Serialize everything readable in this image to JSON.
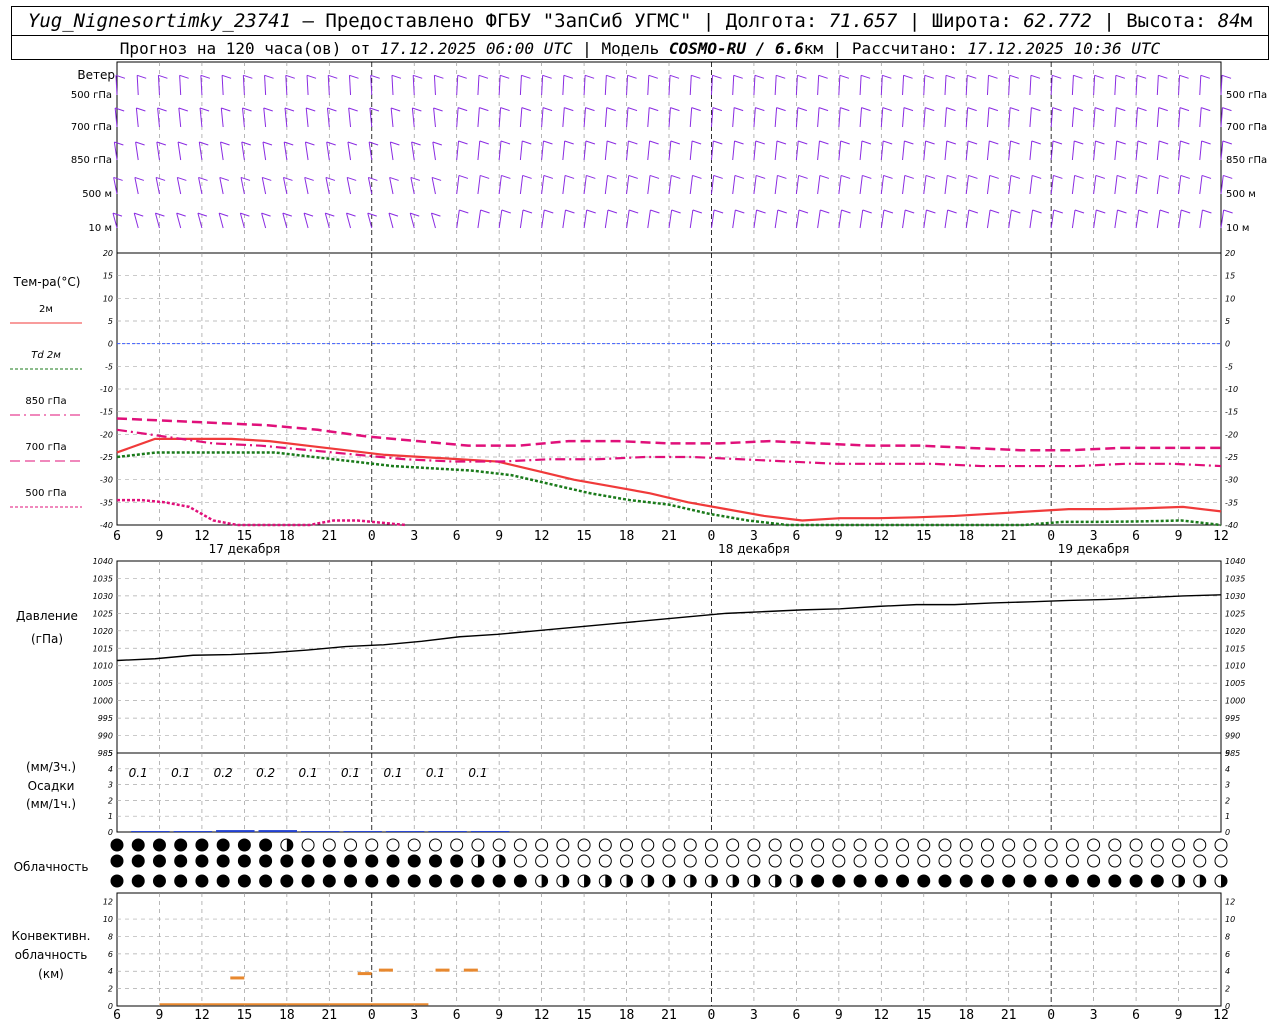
{
  "header": {
    "station": "Yug_Nignesortimky_23741",
    "dash": "—",
    "provider": "Предоставлено ФГБУ \"ЗапСиб УГМС\"",
    "lon_label": "Долгота:",
    "lon": "71.657",
    "lat_label": "Широта:",
    "lat": "62.772",
    "alt_label": "Высота:",
    "alt": "84",
    "alt_unit": "м",
    "forecast_label": "Прогноз на 120 часа(ов) от",
    "forecast_start": "17.12.2025 06:00 UTC",
    "model_label": "Модель",
    "model": "COSMO-RU / 6.6",
    "model_unit": "км",
    "calc_label": "Рассчитано:",
    "calc_time": "17.12.2025 10:36 UTC"
  },
  "wind": {
    "title": "Ветер",
    "levels": [
      "500 гПа",
      "700 гПа",
      "850 гПа",
      "500 м",
      "10  м"
    ]
  },
  "temperature": {
    "title": "Тем-ра(°C)",
    "legend": [
      {
        "label": "2м",
        "color": "#f03a3a",
        "style": "solid"
      },
      {
        "label": "Td  2м",
        "color": "#1a7a1a",
        "style": "dotted"
      },
      {
        "label": "850 гПа",
        "color": "#e0107a",
        "style": "dashdot"
      },
      {
        "label": "700 гПа",
        "color": "#e0107a",
        "style": "dash"
      },
      {
        "label": "500 гПа",
        "color": "#e0107a",
        "style": "dotted"
      }
    ],
    "yticks": [
      "20",
      "15",
      "10",
      "5",
      "0",
      "-5",
      "-10",
      "-15",
      "-20",
      "-25",
      "-30",
      "-35",
      "-40"
    ]
  },
  "pressure": {
    "title1": "Давление",
    "title2": "(гПа)",
    "yticks": [
      "1040",
      "1035",
      "1030",
      "1025",
      "1020",
      "1015",
      "1010",
      "1005",
      "1000",
      "995",
      "990",
      "985"
    ]
  },
  "precip": {
    "title1": "(мм/3ч.)",
    "title2": "Осадки",
    "title3": "(мм/1ч.)",
    "yticks": [
      "5",
      "4",
      "3",
      "2",
      "1",
      "0"
    ],
    "amounts": [
      "0.1",
      "0.1",
      "0.2",
      "0.2",
      "0.1",
      "0.1",
      "0.1",
      "0.1",
      "0.1"
    ]
  },
  "cloud": {
    "title": "Облачность"
  },
  "convective": {
    "title1": "Конвективн.",
    "title2": "облачность",
    "title3": "(км)",
    "yticks": [
      "12",
      "10",
      "8",
      "6",
      "4",
      "2",
      "0"
    ]
  },
  "time_axis": {
    "hour_labels": [
      "6",
      "9",
      "12",
      "15",
      "18",
      "21",
      "0",
      "3",
      "6",
      "9",
      "12",
      "15",
      "18",
      "21",
      "0",
      "3",
      "6",
      "9",
      "12",
      "15",
      "18",
      "21",
      "0",
      "3",
      "6",
      "9",
      "12"
    ],
    "day_labels": [
      "17 декабря",
      "18 декабря",
      "19 декабря"
    ]
  },
  "chart_data": {
    "type": "line",
    "x_hours_from_start": [
      0,
      3,
      6,
      9,
      12,
      15,
      18,
      21,
      24,
      27,
      30,
      33,
      36,
      39,
      42,
      45,
      48,
      51,
      54,
      57,
      60,
      63,
      66,
      69,
      72,
      75,
      78
    ],
    "temp_series": [
      {
        "name": "2м",
        "values": [
          -24,
          -21,
          -21,
          -21,
          -21.5,
          -22.5,
          -23.5,
          -24.5,
          -25,
          -25.5,
          -26,
          -28,
          -30,
          -31.5,
          -33,
          -35,
          -36.5,
          -38,
          -39,
          -38.5,
          -38.5,
          -38.3,
          -38,
          -37.5,
          -37,
          -36.5,
          -36.5,
          -36.3,
          -36,
          -37
        ]
      },
      {
        "name": "Td  2м",
        "values": [
          -25,
          -24,
          -24,
          -24,
          -24,
          -25,
          -26,
          -27,
          -27.5,
          -28,
          -29,
          -31,
          -33,
          -34.5,
          -35.5,
          -37.5,
          -39,
          -40,
          -40,
          -40,
          -40,
          -40,
          -40,
          -40,
          -39.3,
          -39.3,
          -39.2,
          -39,
          -40
        ]
      },
      {
        "name": "850 гПа",
        "values": [
          -19,
          -20.5,
          -22,
          -22.5,
          -23.5,
          -24.5,
          -25.5,
          -26,
          -26,
          -25.5,
          -25.5,
          -25,
          -25,
          -25.5,
          -26,
          -26.5,
          -26.5,
          -26.5,
          -27,
          -27,
          -27,
          -26.5,
          -26.5,
          -27
        ]
      },
      {
        "name": "700 гПа",
        "values": [
          -16.5,
          -17,
          -17.5,
          -18,
          -19,
          -20.5,
          -21.5,
          -22.5,
          -22.5,
          -21.5,
          -21.5,
          -22,
          -22,
          -21.5,
          -22,
          -22.5,
          -22.5,
          -23,
          -23.5,
          -23.5,
          -23,
          -23,
          -23
        ]
      },
      {
        "name": "500 гПа",
        "values": [
          -34.5,
          -34.5,
          -35,
          -36,
          -39,
          -40,
          -40,
          -40,
          -40,
          -39,
          -39,
          -39.5,
          -40
        ]
      }
    ],
    "pressure": [
      1011.5,
      1012,
      1013,
      1013.2,
      1013.7,
      1014.5,
      1015.5,
      1016,
      1017,
      1018.3,
      1019,
      1020,
      1021,
      1022,
      1023,
      1024,
      1025,
      1025.5,
      1026,
      1026.3,
      1027,
      1027.5,
      1027.5,
      1028,
      1028.3,
      1028.7,
      1029,
      1029.5,
      1030,
      1030.3
    ],
    "precip_3h": [
      0.1,
      0.1,
      0.2,
      0.2,
      0.1,
      0.1,
      0.1,
      0.1,
      0.1
    ],
    "convective_cloud_km": [
      {
        "t": 8.5,
        "top": 3.4,
        "base": 3.2
      },
      {
        "t": 17.5,
        "top": 3.9,
        "base": 3.7
      },
      {
        "t": 19,
        "top": 4.3,
        "base": 4.1
      },
      {
        "t": 23,
        "top": 4.3,
        "base": 4.1
      },
      {
        "t": 25,
        "top": 4.3,
        "base": 4.1
      }
    ],
    "ylim_temp": [
      -40,
      20
    ],
    "ylim_pressure": [
      985,
      1040
    ],
    "ylim_precip": [
      0,
      5
    ],
    "ylim_convective": [
      0,
      13
    ],
    "grid": true
  },
  "colors": {
    "wind": "#8a2be2",
    "temp2m": "#f03a3a",
    "dew": "#1a7a1a",
    "upper": "#e0107a",
    "pressure": "#000000",
    "precip": "#1f3fd0",
    "convective": "#e8882e",
    "zero_line": "#3b5bff"
  }
}
